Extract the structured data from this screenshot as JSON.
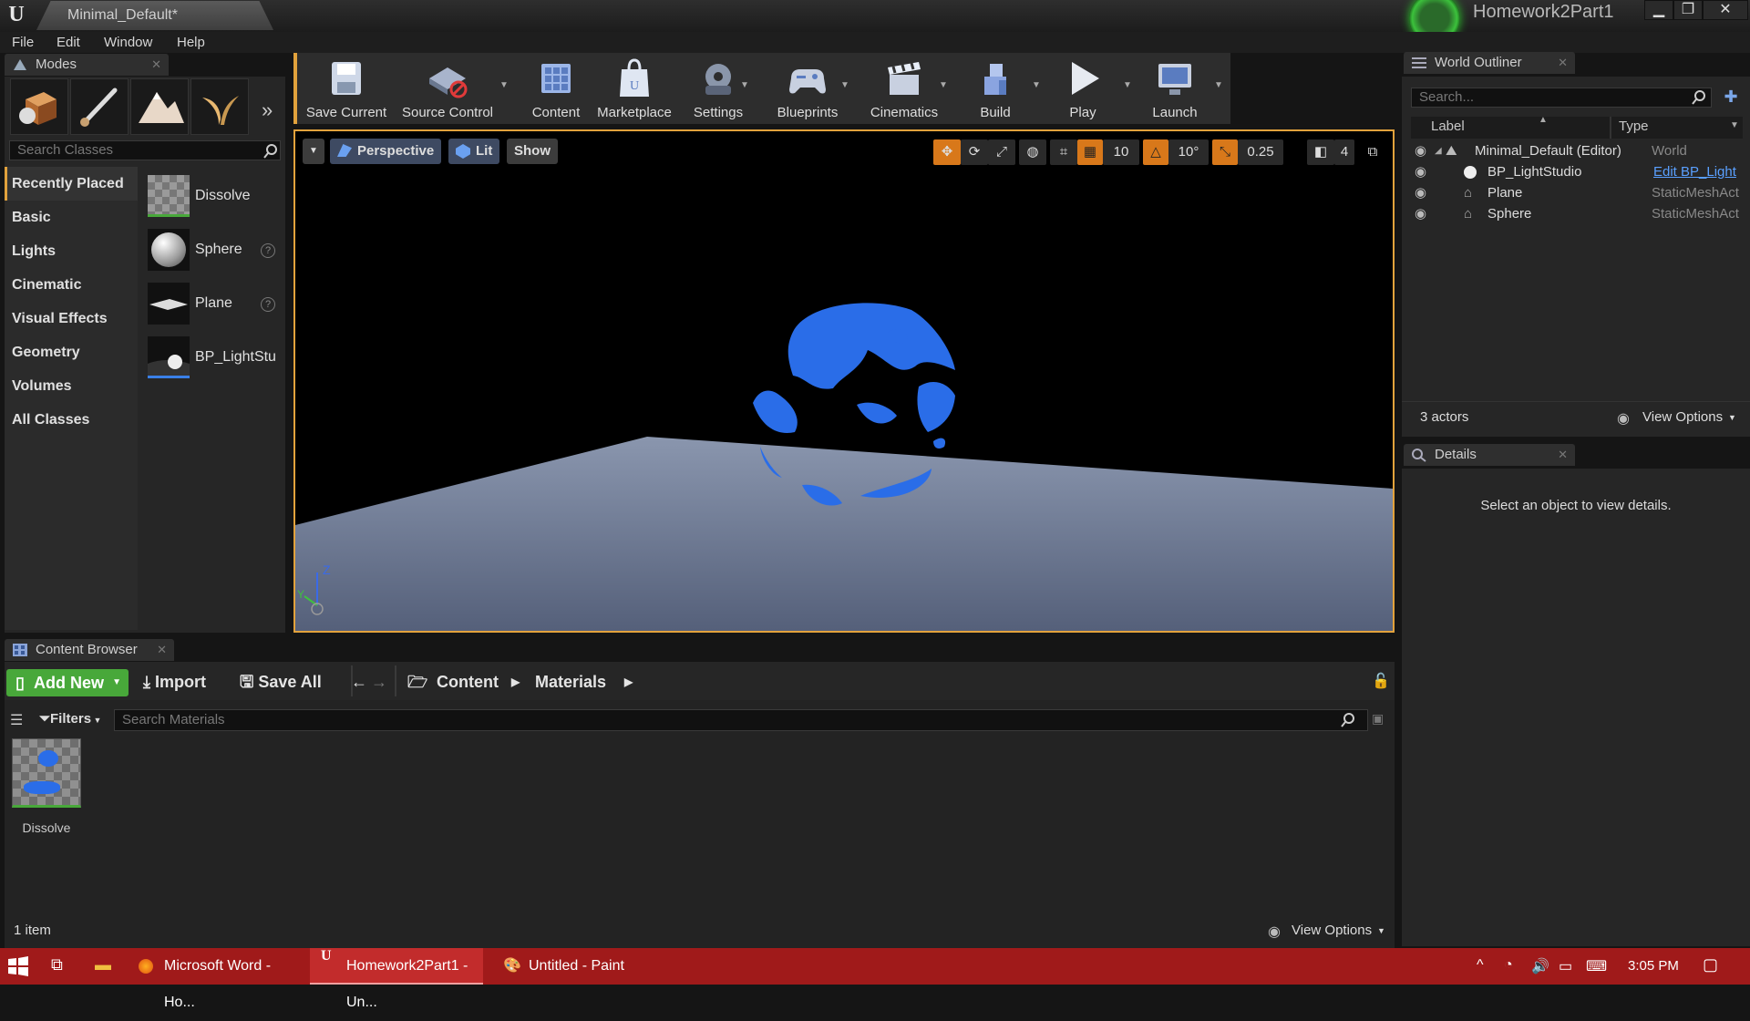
{
  "titlebar": {
    "doc_tab": "Minimal_Default*",
    "project": "Homework2Part1",
    "minimize": "▁",
    "restore": "❐",
    "close": "✕"
  },
  "menu": [
    "File",
    "Edit",
    "Window",
    "Help"
  ],
  "modes": {
    "tab_label": "Modes",
    "search_placeholder": "Search Classes",
    "categories": [
      "Recently Placed",
      "Basic",
      "Lights",
      "Cinematic",
      "Visual Effects",
      "Geometry",
      "Volumes",
      "All Classes"
    ],
    "selected_category": "Recently Placed",
    "items": [
      {
        "label": "Dissolve",
        "icon": "material-thumbnail",
        "help": false
      },
      {
        "label": "Sphere",
        "icon": "sphere-thumbnail",
        "help": true
      },
      {
        "label": "Plane",
        "icon": "plane-thumbnail",
        "help": true
      },
      {
        "label": "BP_LightStu",
        "icon": "blueprint-thumbnail",
        "help": false
      }
    ]
  },
  "toolbar": {
    "save_current": "Save Current",
    "source_control": "Source Control",
    "content": "Content",
    "marketplace": "Marketplace",
    "settings": "Settings",
    "blueprints": "Blueprints",
    "cinematics": "Cinematics",
    "build": "Build",
    "play": "Play",
    "launch": "Launch"
  },
  "viewport": {
    "perspective": "Perspective",
    "lit": "Lit",
    "show": "Show",
    "grid_snap": "10",
    "rotation_snap": "10°",
    "scale_snap": "0.25",
    "camera_speed": "4",
    "axis_z": "Z",
    "axis_y": "Y"
  },
  "outliner": {
    "tab_label": "World Outliner",
    "search_placeholder": "Search...",
    "col_label": "Label",
    "col_type": "Type",
    "rows": [
      {
        "label": "Minimal_Default (Editor)",
        "type": "World",
        "type_link": false
      },
      {
        "label": "BP_LightStudio",
        "type": "Edit BP_Light",
        "type_link": true
      },
      {
        "label": "Plane",
        "type": "StaticMeshAct",
        "type_link": false
      },
      {
        "label": "Sphere",
        "type": "StaticMeshAct",
        "type_link": false
      }
    ],
    "actor_count": "3 actors",
    "view_options": "View Options"
  },
  "details": {
    "tab_label": "Details",
    "empty_text": "Select an object to view details."
  },
  "content_browser": {
    "tab_label": "Content Browser",
    "add_new": "Add New",
    "import": "Import",
    "save_all": "Save All",
    "path": [
      "Content",
      "Materials"
    ],
    "filters": "Filters",
    "search_placeholder": "Search Materials",
    "assets": [
      {
        "name": "Dissolve"
      }
    ],
    "item_count": "1 item",
    "view_options": "View Options"
  },
  "taskbar": {
    "apps": [
      {
        "label": "Microsoft Word - Ho...",
        "active": false
      },
      {
        "label": "Homework2Part1 - Un...",
        "active": true
      },
      {
        "label": "Untitled - Paint",
        "active": false
      }
    ],
    "clock": "3:05 PM"
  },
  "colors": {
    "accent": "#e2a23c",
    "add_new": "#48a83a",
    "taskbar": "#a01a1a",
    "sphere_blue": "#2a6de8"
  }
}
